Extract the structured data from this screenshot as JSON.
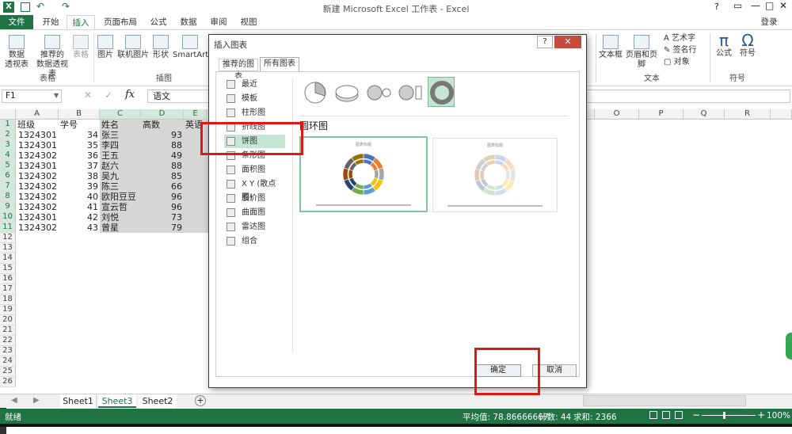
{
  "window": {
    "title": "新建 Microsoft Excel 工作表 - Excel",
    "help": "?",
    "login": "登录"
  },
  "tabs": [
    "文件",
    "开始",
    "插入",
    "页面布局",
    "公式",
    "数据",
    "审阅",
    "视图"
  ],
  "ribbon": {
    "pivot": "数据\n透视表",
    "pivot_a": "数据",
    "pivot_b": "透视表",
    "rec_pivot_a": "推荐的",
    "rec_pivot_b": "数据透视表",
    "table": "表格",
    "group_table": "表格",
    "picture": "图片",
    "online_picture": "联机图片",
    "shapes": "形状",
    "smartart": "SmartArt",
    "group_illus": "插图",
    "textbox": "文本框",
    "header_footer": "页眉和页脚",
    "wordart": "艺术字",
    "signature": "签名行",
    "object": "对象",
    "group_text": "文本",
    "formula": "公式",
    "symbol": "符号",
    "group_symbol": "符号",
    "formula_glyph": "π",
    "symbol_glyph": "Ω"
  },
  "formula_bar": {
    "name_box": "F1",
    "fx": "fx",
    "content": "语文"
  },
  "columns": [
    "A",
    "B",
    "C",
    "D",
    "E",
    "O",
    "P",
    "Q",
    "R"
  ],
  "rows": [
    "1",
    "2",
    "3",
    "4",
    "5",
    "6",
    "7",
    "8",
    "9",
    "10",
    "11",
    "12",
    "13",
    "14",
    "15",
    "16",
    "17",
    "18",
    "19",
    "20",
    "21",
    "22",
    "23",
    "24",
    "25",
    "26"
  ],
  "table": {
    "headers": [
      "班级",
      "学号",
      "姓名",
      "高数",
      "英语"
    ],
    "rows": [
      [
        "1324301",
        "34",
        "张三",
        "93"
      ],
      [
        "1324301",
        "35",
        "李四",
        "88"
      ],
      [
        "1324302",
        "36",
        "王五",
        "49"
      ],
      [
        "1324301",
        "37",
        "赵六",
        "88"
      ],
      [
        "1324302",
        "38",
        "吴九",
        "85"
      ],
      [
        "1324302",
        "39",
        "陈三",
        "66"
      ],
      [
        "1324302",
        "40",
        "欧阳豆豆",
        "96"
      ],
      [
        "1324302",
        "41",
        "宣云哲",
        "96"
      ],
      [
        "1324301",
        "42",
        "刘悦",
        "73"
      ],
      [
        "1324302",
        "43",
        "曾星",
        "79"
      ]
    ]
  },
  "sheets": [
    "Sheet1",
    "Sheet3",
    "Sheet2"
  ],
  "status": {
    "ready": "就绪",
    "avg": "平均值: 78.86666667",
    "count": "计数: 44",
    "sum": "求和: 2366",
    "zoom": "100%"
  },
  "dialog": {
    "title": "插入图表",
    "help": "?",
    "tab_recommended": "推荐的图表",
    "tab_all": "所有图表",
    "chart_types": [
      "最近",
      "模板",
      "柱形图",
      "折线图",
      "饼图",
      "条形图",
      "面积图",
      "X Y (散点图)",
      "股价图",
      "曲面图",
      "雷达图",
      "组合"
    ],
    "section_title": "圆环图",
    "preview_title": "图表标题",
    "ok": "确定",
    "cancel": "取消"
  },
  "colors": {
    "excel_green": "#217346",
    "selection": "#d6d6d6",
    "highlight_green": "#c6e6d4",
    "red": "#e01717"
  }
}
